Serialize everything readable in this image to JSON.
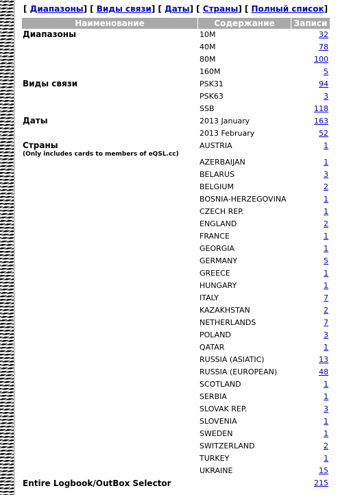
{
  "nav": [
    {
      "label": "Диапазоны"
    },
    {
      "label": "Виды связи"
    },
    {
      "label": "Даты"
    },
    {
      "label": "Страны"
    },
    {
      "label": "Полный список"
    }
  ],
  "table": {
    "headers": {
      "name": "Наименование",
      "content": "Содержание",
      "count": "Записи"
    },
    "sections": {
      "bands": {
        "title": "Диапазоны",
        "rows": [
          {
            "value": "10M",
            "count": "32"
          },
          {
            "value": "40M",
            "count": "78"
          },
          {
            "value": "80M",
            "count": "100"
          },
          {
            "value": "160M",
            "count": "5"
          }
        ]
      },
      "modes": {
        "title": "Виды связи",
        "rows": [
          {
            "value": "PSK31",
            "count": "94"
          },
          {
            "value": "PSK63",
            "count": "3"
          },
          {
            "value": "SSB",
            "count": "118"
          }
        ]
      },
      "dates": {
        "title": "Даты",
        "rows": [
          {
            "value": "2013 January",
            "count": "163"
          },
          {
            "value": "2013 February",
            "count": "52"
          }
        ]
      },
      "countries": {
        "title": "Страны",
        "note": "(Only includes cards to members of eQSL.cc)",
        "rows": [
          {
            "value": "AUSTRIA",
            "count": "1"
          },
          {
            "value": "AZERBAIJAN",
            "count": "1"
          },
          {
            "value": "BELARUS",
            "count": "3"
          },
          {
            "value": "BELGIUM",
            "count": "2"
          },
          {
            "value": "BOSNIA-HERZEGOVINA",
            "count": "1"
          },
          {
            "value": "CZECH REP.",
            "count": "1"
          },
          {
            "value": "ENGLAND",
            "count": "2"
          },
          {
            "value": "FRANCE",
            "count": "1"
          },
          {
            "value": "GEORGIA",
            "count": "1"
          },
          {
            "value": "GERMANY",
            "count": "5"
          },
          {
            "value": "GREECE",
            "count": "1"
          },
          {
            "value": "HUNGARY",
            "count": "1"
          },
          {
            "value": "ITALY",
            "count": "7"
          },
          {
            "value": "KAZAKHSTAN",
            "count": "2"
          },
          {
            "value": "NETHERLANDS",
            "count": "7"
          },
          {
            "value": "POLAND",
            "count": "3"
          },
          {
            "value": "QATAR",
            "count": "1"
          },
          {
            "value": "RUSSIA (ASIATIC)",
            "count": "13"
          },
          {
            "value": "RUSSIA (EUROPEAN)",
            "count": "48"
          },
          {
            "value": "SCOTLAND",
            "count": "1"
          },
          {
            "value": "SERBIA",
            "count": "1"
          },
          {
            "value": "SLOVAK REP.",
            "count": "3"
          },
          {
            "value": "SLOVENIA",
            "count": "1"
          },
          {
            "value": "SWEDEN",
            "count": "1"
          },
          {
            "value": "SWITZERLAND",
            "count": "2"
          },
          {
            "value": "TURKEY",
            "count": "1"
          },
          {
            "value": "UKRAINE",
            "count": "15"
          }
        ]
      }
    },
    "footer": {
      "label": "Entire Logbook/OutBox Selector",
      "count": "215"
    }
  }
}
